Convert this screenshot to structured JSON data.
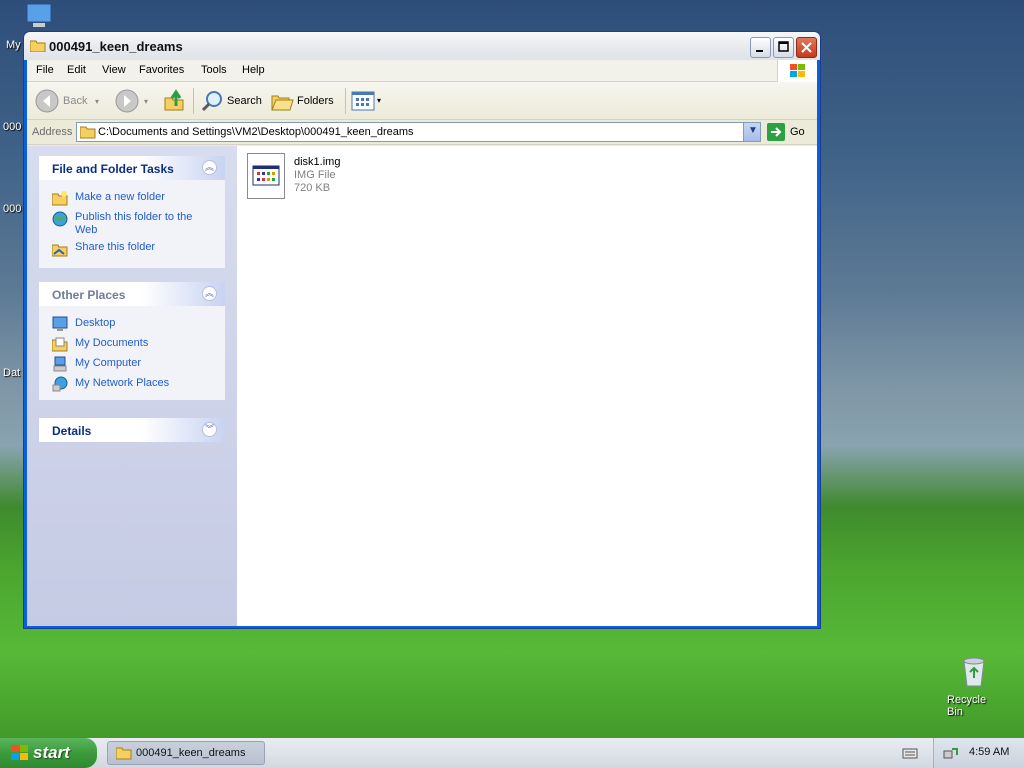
{
  "desktop": {
    "left_labels": [
      "My",
      "000",
      "000",
      "Dat"
    ],
    "recycle_bin_label": "Recycle Bin"
  },
  "window": {
    "title": "000491_keen_dreams",
    "menu": [
      "File",
      "Edit",
      "View",
      "Favorites",
      "Tools",
      "Help"
    ],
    "toolbar": {
      "back_label": "Back",
      "search_label": "Search",
      "folders_label": "Folders"
    },
    "address": {
      "label": "Address",
      "value": "C:\\Documents and Settings\\VM2\\Desktop\\000491_keen_dreams",
      "go_label": "Go"
    },
    "sidebar": {
      "file_tasks": {
        "title": "File and Folder Tasks",
        "items": [
          "Make a new folder",
          "Publish this folder to the Web",
          "Share this folder"
        ]
      },
      "other_places": {
        "title": "Other Places",
        "items": [
          "Desktop",
          "My Documents",
          "My Computer",
          "My Network Places"
        ]
      },
      "details": {
        "title": "Details"
      }
    },
    "files": [
      {
        "name": "disk1.img",
        "type": "IMG File",
        "size": "720 KB"
      }
    ]
  },
  "taskbar": {
    "start_label": "start",
    "task_title": "000491_keen_dreams",
    "clock": "4:59 AM"
  }
}
